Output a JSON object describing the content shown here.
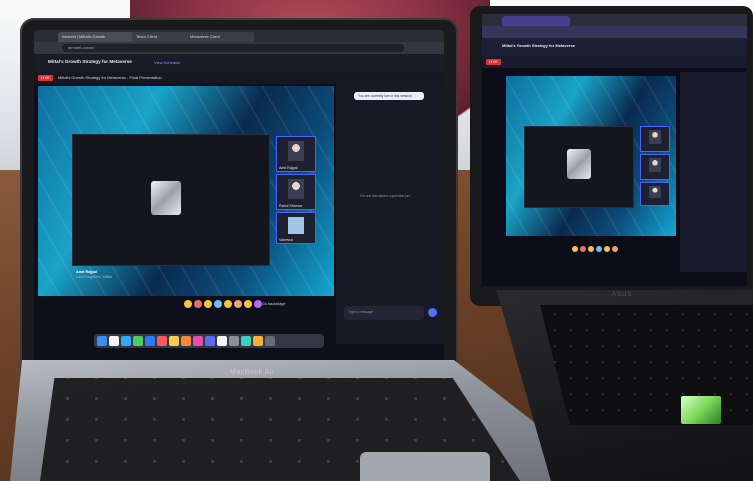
{
  "scene": {
    "left_laptop": {
      "brand": "MacBook Air",
      "browser": {
        "tabs": [
          {
            "label": "Airmeet | Mittal's Growth",
            "active": true
          },
          {
            "label": "Team Client",
            "active": false
          },
          {
            "label": "Metaverse Client",
            "active": false
          }
        ],
        "url": "airmeet.com/e/"
      },
      "app": {
        "event_title": "Mittal's Growth Strategy for Metaverse",
        "schedule_link": "View Schedule",
        "live_badge": "LIVE",
        "session_title": "Mittal's Growth Strategy for Metaverse - Final Presentation",
        "presenter_name": "Amit Rajpal",
        "presenter_role": "Lead Engineer, Mittal",
        "speakers": [
          {
            "name": "Amit Rajpal"
          },
          {
            "name": "Rahul Sharma"
          },
          {
            "name": "Vanessa"
          }
        ],
        "backstage_label": "Go backstage",
        "tip_text": "You are currently live in this session",
        "empty_hint": "No one has asked a question yet",
        "chat_placeholder": "Type a message"
      }
    },
    "right_laptop": {
      "brand": "ASUS",
      "app": {
        "event_title": "Mittal's Growth Strategy for Metaverse",
        "live_badge": "LIVE"
      }
    }
  }
}
